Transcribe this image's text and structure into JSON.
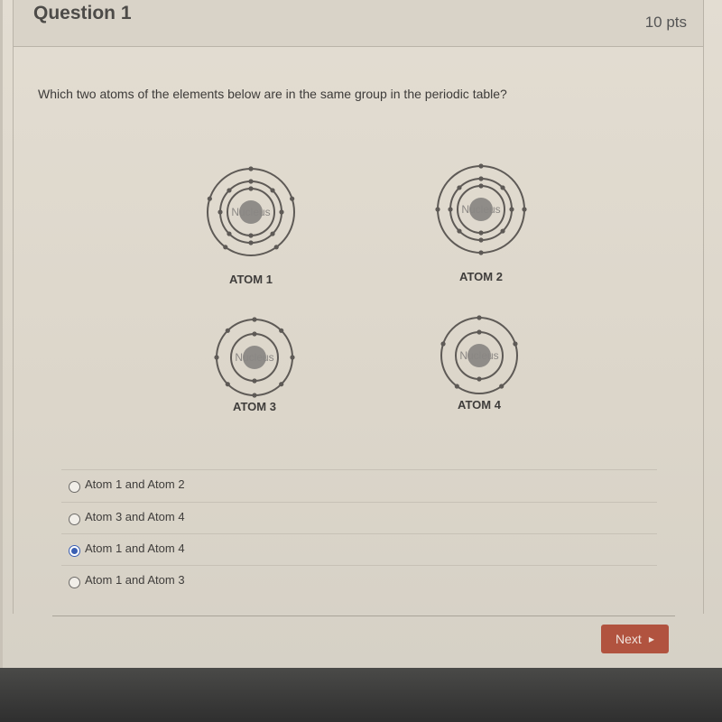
{
  "question": {
    "title": "Question 1",
    "points": "10 pts",
    "text": "Which two atoms of the elements below are in the same group in the periodic table?"
  },
  "diagram": {
    "nucleus_label": "Nucleus",
    "atoms": [
      {
        "label": "ATOM 1",
        "shells": [
          2,
          8,
          5
        ]
      },
      {
        "label": "ATOM 2",
        "shells": [
          2,
          8,
          4
        ]
      },
      {
        "label": "ATOM 3",
        "shells": [
          2,
          8
        ]
      },
      {
        "label": "ATOM 4",
        "shells": [
          2,
          5
        ]
      }
    ]
  },
  "answers": [
    {
      "label": "Atom 1 and Atom 2",
      "selected": false
    },
    {
      "label": "Atom 3 and Atom 4",
      "selected": false
    },
    {
      "label": "Atom 1 and Atom 4",
      "selected": true
    },
    {
      "label": "Atom 1 and Atom 3",
      "selected": false
    }
  ],
  "buttons": {
    "next_label": "Next",
    "next_icon": "play-triangle-icon"
  },
  "colors": {
    "next_button": "#b1533f",
    "radio_selected": "#3a5fb3"
  }
}
